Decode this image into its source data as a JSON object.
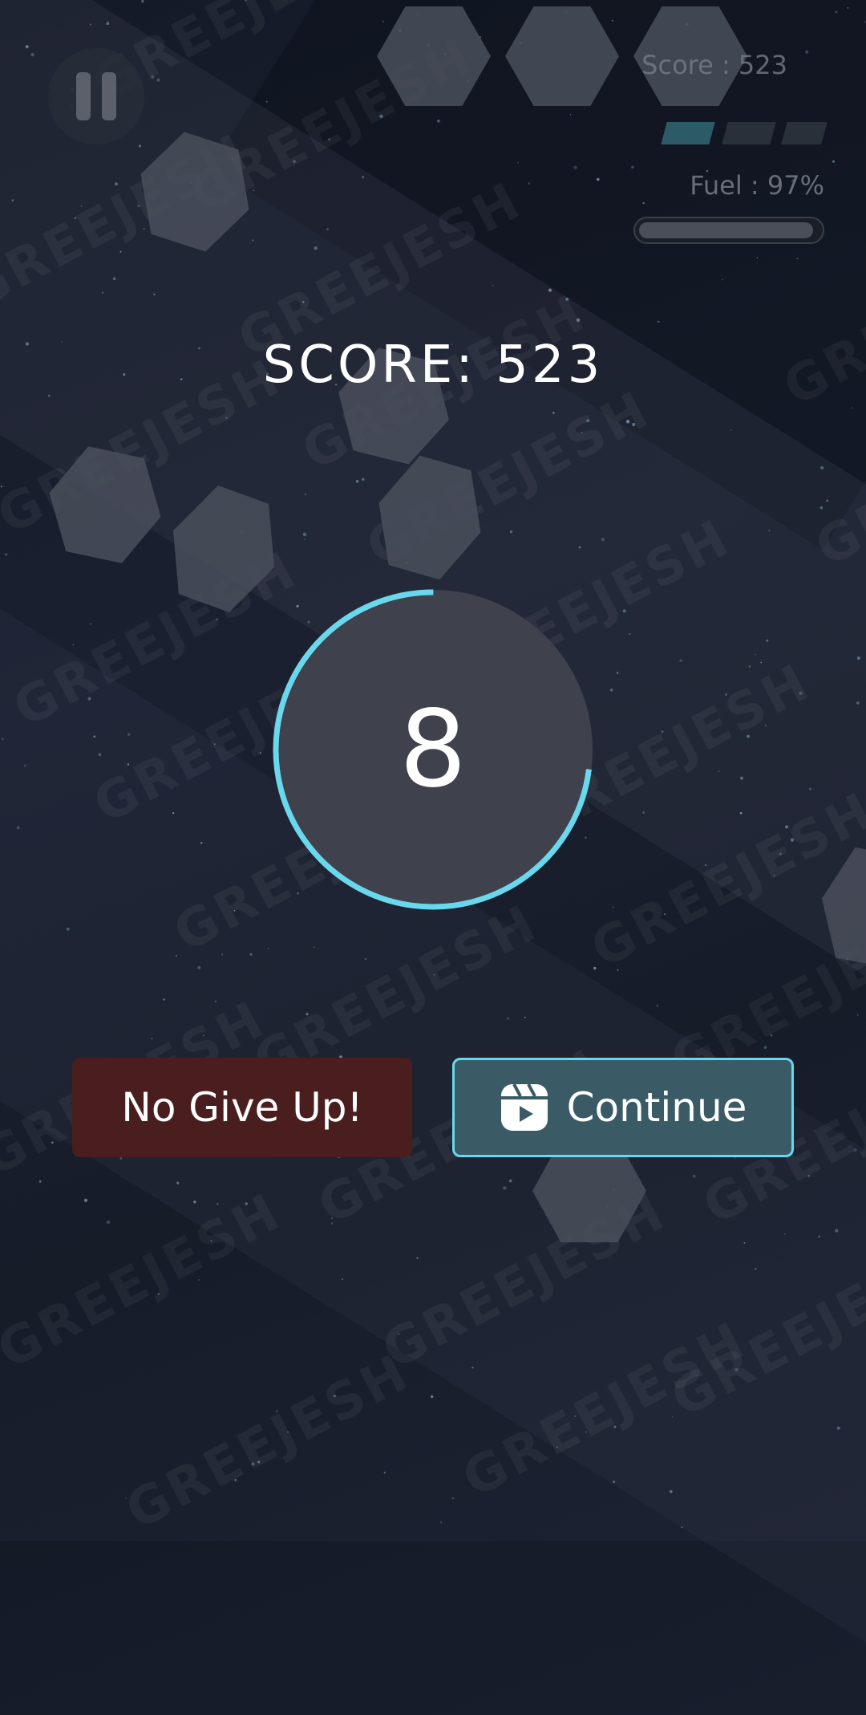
{
  "hud": {
    "score_text": "Score : 523",
    "fuel_text": "Fuel : 97%",
    "fuel_fraction": 0.97
  },
  "dialog": {
    "score_title": "SCORE: 523",
    "countdown": "8",
    "countdown_progress": 0.73,
    "give_up_label": "No Give Up!",
    "continue_label": "Continue"
  },
  "watermark": "GREEJESH",
  "colors": {
    "accent": "#6ad8ec",
    "give_up_bg": "#4a1e1e",
    "continue_bg": "#3a5a66"
  },
  "icons": {
    "pause": "pause-icon",
    "continue": "reels-play-icon"
  }
}
